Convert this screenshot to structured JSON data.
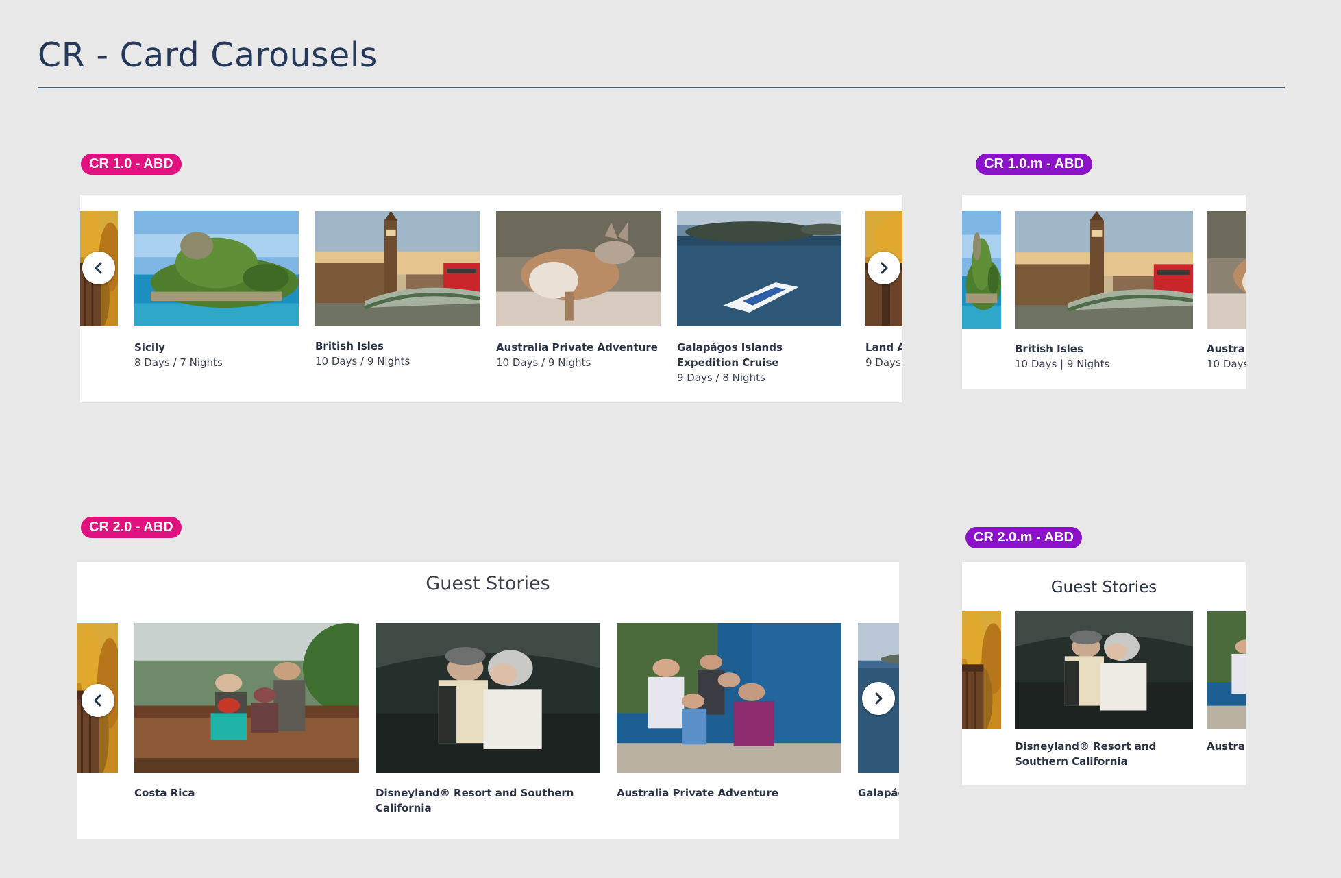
{
  "page": {
    "title": "CR - Card Carousels"
  },
  "cr1": {
    "badge": "CR 1.0 - ABD",
    "cards": [
      {
        "title": "Sicily",
        "sub": "8 Days / 7 Nights",
        "image": "sicily-island-photo"
      },
      {
        "title": "British Isles",
        "sub": "10 Days / 9 Nights",
        "image": "london-big-ben-photo"
      },
      {
        "title": "Australia Private Adventure",
        "sub": "10 Days / 9 Nights",
        "image": "kangaroo-photo"
      },
      {
        "title": "Galapágos Islands Expedition Cruise",
        "sub": "9 Days / 8 Nights",
        "image": "cruise-ship-photo"
      },
      {
        "title": "Land A",
        "sub": "9 Days ."
      }
    ]
  },
  "cr1m": {
    "badge": "CR 1.0.m - ABD",
    "cards": [
      {
        "title": "British Isles",
        "sub": "10 Days | 9 Nights"
      },
      {
        "title": "Australi",
        "sub": "10 Days"
      }
    ]
  },
  "cr2": {
    "badge": "CR 2.0 - ABD",
    "heading": "Guest Stories",
    "cards": [
      {
        "title": "Costa Rica",
        "image": "family-ziplining-photo"
      },
      {
        "title": "Disneyland® Resort and Southern California",
        "image": "couple-kissing-cockpit-photo"
      },
      {
        "title": "Australia Private Adventure",
        "image": "family-coast-photo"
      },
      {
        "title": "Galapág"
      }
    ]
  },
  "cr2m": {
    "badge": "CR 2.0.m - ABD",
    "heading": "Guest Stories",
    "cards": [
      {
        "title": "Disneyland® Resort and Southern California"
      },
      {
        "title": "Australi"
      }
    ]
  },
  "icons": {
    "prev": "chevron-left-icon",
    "next": "chevron-right-icon"
  },
  "colors": {
    "badge_pink": "#e0127f",
    "badge_purple": "#8b12c9",
    "title": "#253a5a",
    "background": "#e8e8e8"
  }
}
